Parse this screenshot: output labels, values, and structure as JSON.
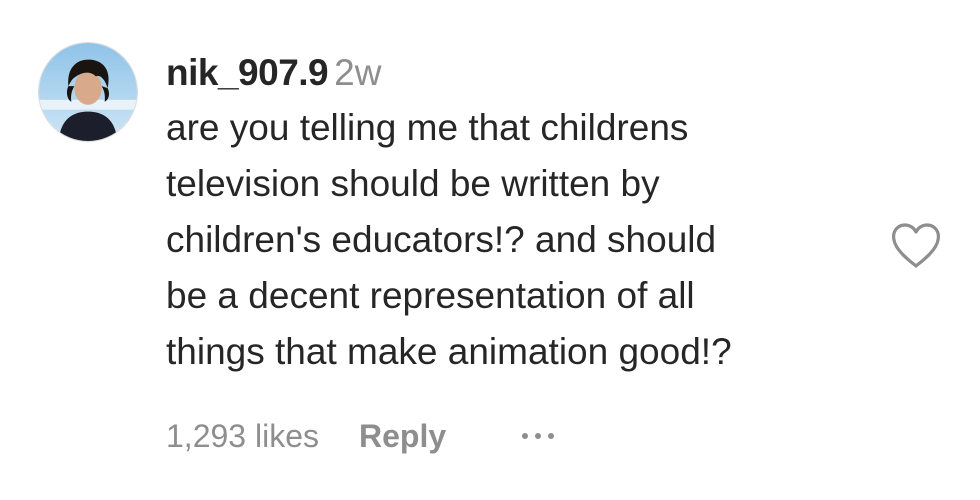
{
  "comment": {
    "username": "nik_907.9",
    "time": "2w",
    "text_lines": [
      "are you telling me that childrens",
      "television should be written by",
      "children's educators!? and should",
      "be a decent representation of all",
      "things that make animation good!?"
    ],
    "likes": "1,293 likes",
    "reply_label": "Reply",
    "more_icon": "more-horizontal-icon",
    "like_icon": "heart-outline-icon"
  },
  "colors": {
    "primary_text": "#262626",
    "secondary_text": "#8e8e8e"
  }
}
